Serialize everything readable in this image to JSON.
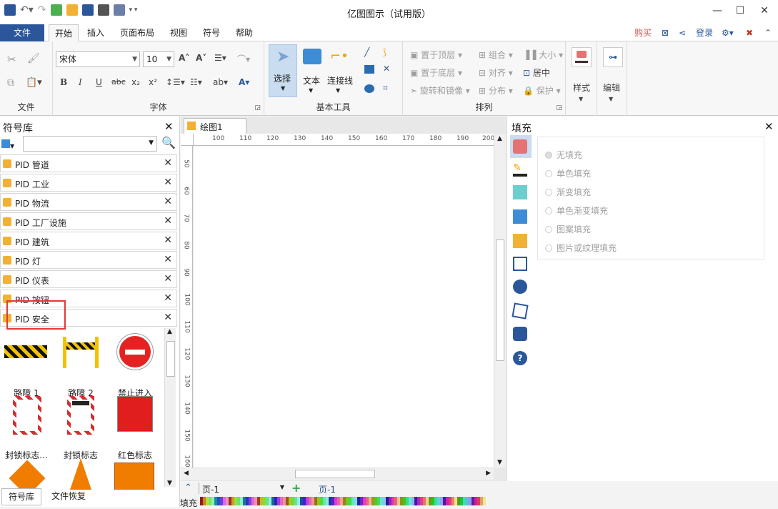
{
  "window": {
    "title": "亿图图示（试用版）"
  },
  "menu": {
    "items": [
      "文件",
      "开始",
      "插入",
      "页面布局",
      "视图",
      "符号",
      "帮助"
    ],
    "right": {
      "buy": "购买",
      "login": "登录"
    }
  },
  "ribbon": {
    "font": {
      "name": "宋体",
      "size": "10",
      "group_label": "字体"
    },
    "file_group_label": "文件",
    "basic_tools": {
      "select": "选择",
      "text": "文本",
      "connector": "连接线",
      "group_label": "基本工具"
    },
    "arrange": {
      "bring_front": "置于顶层",
      "send_back": "置于底层",
      "rotate": "旋转和镜像",
      "group": "组合",
      "align": "对齐",
      "distribute": "分布",
      "size": "大小",
      "center": "居中",
      "protect": "保护",
      "group_label": "排列"
    },
    "style": "样式",
    "edit": "编辑"
  },
  "library": {
    "title": "符号库",
    "search_placeholder": "",
    "items": [
      "PID 管道",
      "PID 工业",
      "PID 物流",
      "PID 工厂设施",
      "PID 建筑",
      "PID 灯",
      "PID 仪表",
      "PID 按钮",
      "PID 安全"
    ],
    "shapes": [
      "路障 1",
      "路障 2",
      "禁止进入",
      "封锁标志...",
      "封锁标志",
      "红色标志"
    ],
    "bottom_tabs": [
      "符号库",
      "文件恢复"
    ]
  },
  "canvas": {
    "tab": "绘图1",
    "ruler_h": [
      "100",
      "110",
      "120",
      "130",
      "140",
      "150",
      "160",
      "170",
      "180",
      "190",
      "200"
    ],
    "ruler_v": [
      "50",
      "60",
      "70",
      "80",
      "90",
      "100",
      "110",
      "120",
      "130",
      "140",
      "150",
      "160"
    ],
    "page_select": "页-1",
    "page_tab": "页-1",
    "fill_label": "填充"
  },
  "fill_panel": {
    "title": "填充",
    "options": [
      "无填充",
      "单色填充",
      "渐变填充",
      "单色渐变填充",
      "图案填充",
      "图片或纹理填充"
    ]
  },
  "colors": {
    "file_menu": "#2b579a",
    "highlight_box": "#e53935",
    "buy": "#d9534f",
    "login": "#2b579a"
  }
}
